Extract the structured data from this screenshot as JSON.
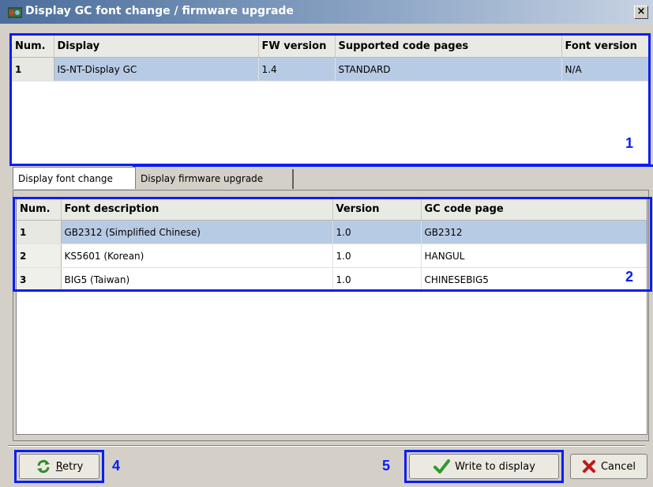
{
  "window": {
    "title": "Display GC font change / firmware upgrade",
    "close_label": "×"
  },
  "displays": {
    "headers": [
      "Num.",
      "Display",
      "FW version",
      "Supported code pages",
      "Font version"
    ],
    "rows": [
      {
        "num": "1",
        "display": "IS-NT-Display GC",
        "fw": "1.4",
        "pages": "STANDARD",
        "font": "N/A"
      }
    ]
  },
  "tabs": {
    "font_change": "Display font change",
    "firmware_upgrade": "Display firmware upgrade"
  },
  "fonts": {
    "headers": [
      "Num.",
      "Font description",
      "Version",
      "GC code page"
    ],
    "rows": [
      {
        "num": "1",
        "desc": "GB2312 (Simplified Chinese)",
        "version": "1.0",
        "page": "GB2312"
      },
      {
        "num": "2",
        "desc": "KS5601 (Korean)",
        "version": "1.0",
        "page": "HANGUL"
      },
      {
        "num": "3",
        "desc": "BIG5 (Taiwan)",
        "version": "1.0",
        "page": "CHINESEBIG5"
      }
    ]
  },
  "buttons": {
    "retry_first": "R",
    "retry_rest": "etry",
    "write": "Write to display",
    "cancel": "Cancel"
  },
  "annotations": {
    "one": "1",
    "two": "2",
    "four": "4",
    "five": "5"
  },
  "colors": {
    "highlight": "#0a1df5",
    "selection": "#b8cbe4"
  }
}
